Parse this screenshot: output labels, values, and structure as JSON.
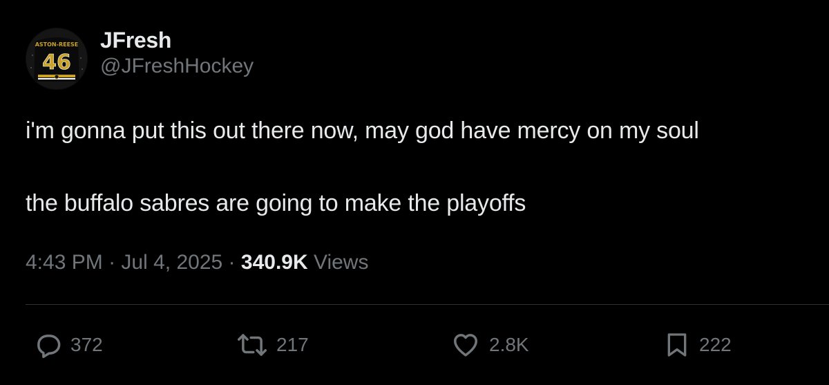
{
  "author": {
    "display_name": "JFresh",
    "handle": "@JFreshHockey",
    "avatar": {
      "jersey_name": "ASTON-REESE",
      "jersey_number": "46",
      "colors": {
        "bg": "#101010",
        "gold": "#c9a227"
      }
    }
  },
  "tweet": {
    "line1": "i'm gonna put this out there now, may god have mercy on my soul",
    "line2": "the buffalo sabres are going to make the playoffs"
  },
  "meta": {
    "time": "4:43 PM",
    "separator": "·",
    "date": "Jul 4, 2025",
    "views_count": "340.9K",
    "views_label": "Views"
  },
  "actions": {
    "replies": "372",
    "reposts": "217",
    "likes": "2.8K",
    "bookmarks": "222"
  },
  "colors": {
    "background": "#000000",
    "primary_text": "#e7e9ea",
    "secondary_text": "#71767b",
    "divider": "#2f3336"
  },
  "icons": [
    "reply-icon",
    "repost-icon",
    "like-icon",
    "bookmark-icon"
  ]
}
